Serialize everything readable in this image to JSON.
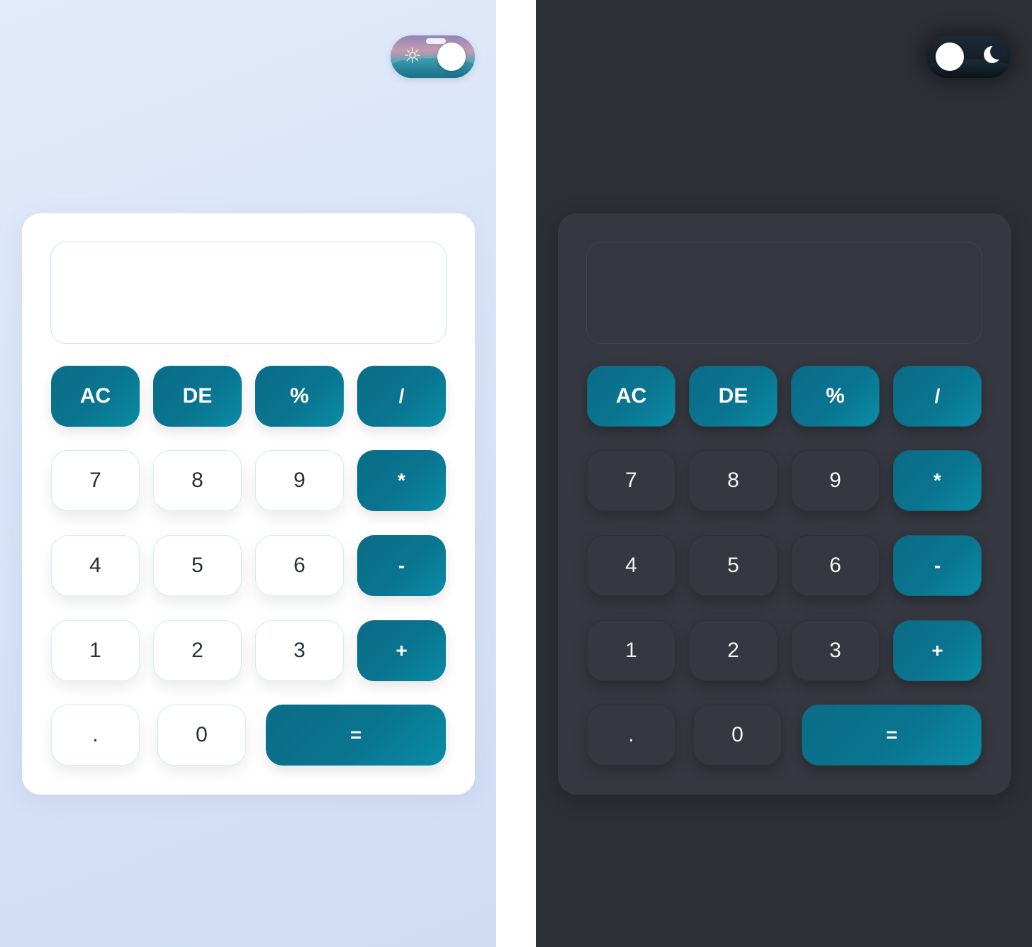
{
  "themes": [
    {
      "id": "light",
      "toggle": {
        "state": "light",
        "icon_sun": "sun-icon"
      },
      "display": {
        "value": ""
      },
      "keys": {
        "ac": "AC",
        "de": "DE",
        "percent": "%",
        "divide": "/",
        "seven": "7",
        "eight": "8",
        "nine": "9",
        "multiply": "*",
        "four": "4",
        "five": "5",
        "six": "6",
        "subtract": "-",
        "one": "1",
        "two": "2",
        "three": "3",
        "add": "+",
        "dot": ".",
        "zero": "0",
        "equals": "="
      }
    },
    {
      "id": "dark",
      "toggle": {
        "state": "dark",
        "icon_moon": "moon-icon"
      },
      "display": {
        "value": ""
      },
      "keys": {
        "ac": "AC",
        "de": "DE",
        "percent": "%",
        "divide": "/",
        "seven": "7",
        "eight": "8",
        "nine": "9",
        "multiply": "*",
        "four": "4",
        "five": "5",
        "six": "6",
        "subtract": "-",
        "one": "1",
        "two": "2",
        "three": "3",
        "add": "+",
        "dot": ".",
        "zero": "0",
        "equals": "="
      }
    }
  ],
  "colors": {
    "accent": "#0a7590",
    "light_bg": "#dbe6f8",
    "dark_bg": "#2c2f35",
    "dark_card": "#353840"
  }
}
